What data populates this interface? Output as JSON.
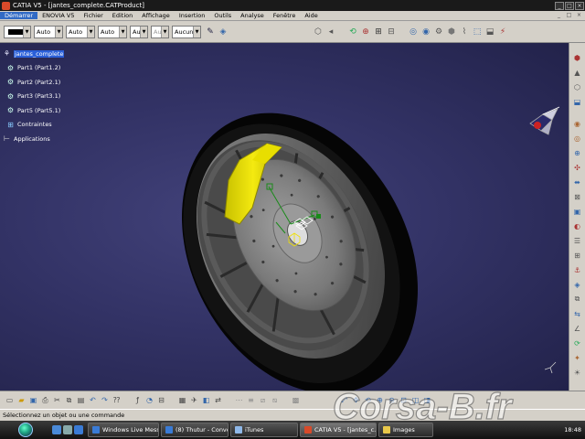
{
  "window": {
    "title": "CATIA V5 - [jantes_complete.CATProduct]",
    "min_glyph": "_",
    "max_glyph": "□",
    "close_glyph": "×"
  },
  "menu": {
    "items": [
      "Démarrer",
      "ENOVIA V5",
      "Fichier",
      "Edition",
      "Affichage",
      "Insertion",
      "Outils",
      "Analyse",
      "Fenêtre",
      "Aide"
    ],
    "active_index": 0
  },
  "toolbar": {
    "combos": [
      {
        "value": "",
        "kind": "color"
      },
      {
        "value": "Auto"
      },
      {
        "value": "Auto"
      },
      {
        "value": "Auto"
      },
      {
        "value": "Aut"
      },
      {
        "value": "Aul",
        "disabled": true
      },
      {
        "value": "Aucun"
      }
    ],
    "arrow_glyph": "▼"
  },
  "tree": {
    "items": [
      {
        "label": "jantes_complete",
        "icon": "product-icon",
        "selected": true
      },
      {
        "label": "Part1 (Part1.2)",
        "icon": "part-icon"
      },
      {
        "label": "Part2 (Part2.1)",
        "icon": "part-icon"
      },
      {
        "label": "Part3 (Part3.1)",
        "icon": "part-icon"
      },
      {
        "label": "Part5 (Part5.1)",
        "icon": "part-icon"
      },
      {
        "label": "Contraintes",
        "icon": "constraints-icon"
      },
      {
        "label": "Applications",
        "icon": "applications-icon"
      }
    ]
  },
  "status": {
    "text": "Sélectionnez un objet ou une commande"
  },
  "taskbar": {
    "tasks": [
      {
        "label": "Windows Live Mess...",
        "color": "#3a7bd5"
      },
      {
        "label": "(8) Thutur - Convers...",
        "color": "#3a7bd5"
      },
      {
        "label": "iTunes",
        "color": "#8fb8e8"
      },
      {
        "label": "CATIA V5 - [jantes_c...",
        "color": "#d84a2a",
        "active": true
      },
      {
        "label": "Images",
        "color": "#e8c84a"
      }
    ],
    "clock": "18:48"
  },
  "watermark": {
    "text": "Corsa-B.fr"
  },
  "colors": {
    "viewport_bg": "#333366",
    "caliper": "#f0e000",
    "tire": "#0a0a0a",
    "disc": "#8a8a8a",
    "rim": "#6e6e6e",
    "selection": "#2a5fd8"
  },
  "icons": {
    "left_toolbar": [
      "brush-icon",
      "paint-icon"
    ],
    "top_toolbar": [
      "assembly-icon",
      "pan-icon",
      "rotate-icon",
      "zoom-icon",
      "constraint-icon",
      "snap-icon",
      "explode-icon",
      "measure-icon",
      "analysis-icon",
      "render-icon",
      "light-icon",
      "hide-icon"
    ],
    "right_toolbar": [
      "workbench-icon",
      "analysis-icon",
      "clash-icon",
      "section-icon",
      "measure-icon",
      "mass-icon",
      "distance-icon",
      "explode-icon",
      "move-icon",
      "snap-icon",
      "scene-icon",
      "catalog-icon",
      "bom-icon",
      "constraint-icon",
      "fix-icon",
      "coincidence-icon",
      "contact-icon",
      "offset-icon",
      "angle-icon",
      "update-icon",
      "render-icon"
    ],
    "bottom_toolbar": [
      "new-icon",
      "open-icon",
      "save-icon",
      "print-icon",
      "cut-icon",
      "copy-icon",
      "paste-icon",
      "undo-icon",
      "redo-icon",
      "whatsthis-icon",
      "formula-icon",
      "knowledge-icon",
      "table-icon",
      "catalog-icon",
      "fly-icon",
      "fit-all-icon",
      "pan-icon",
      "rotate-icon",
      "zoom-in-icon",
      "zoom-out-icon",
      "normal-view-icon",
      "views-icon",
      "render-style-icon",
      "hide-show-icon",
      "swap-icon"
    ]
  }
}
